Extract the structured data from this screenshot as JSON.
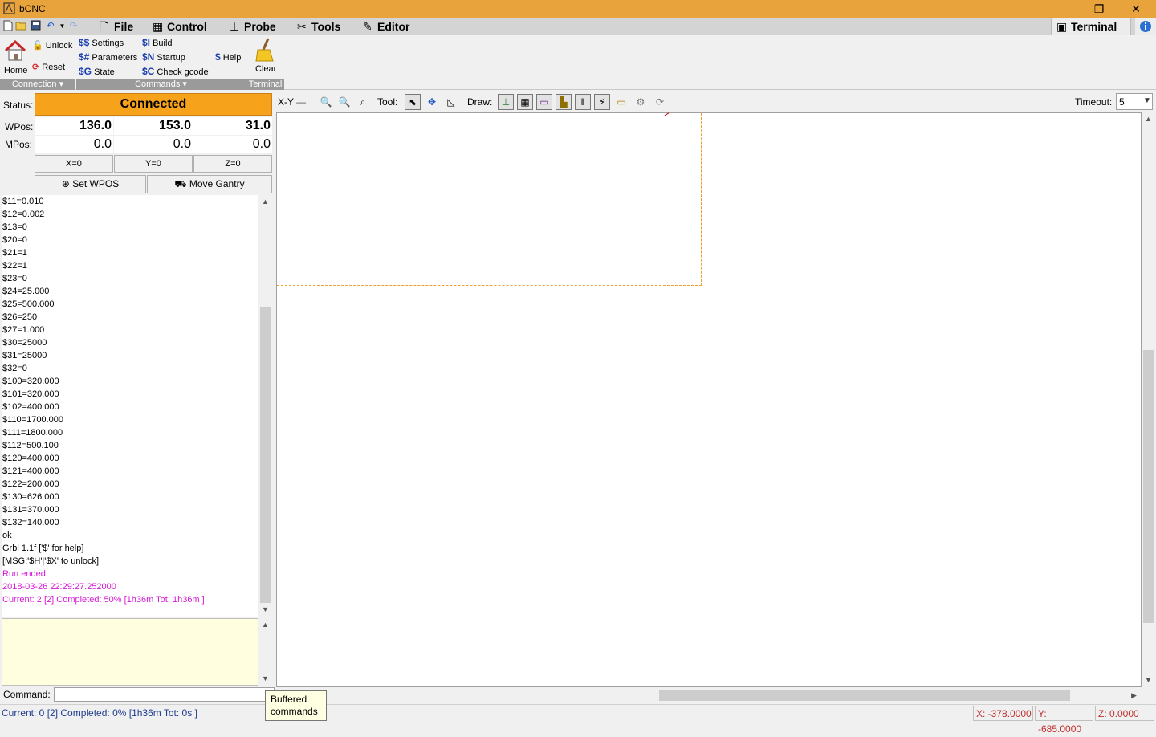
{
  "window": {
    "title": "bCNC",
    "minimize_glyph": "–",
    "restore_glyph": "❐",
    "close_glyph": "✕"
  },
  "quick_access": [
    "new-icon",
    "open-icon",
    "save-icon",
    "undo-icon",
    "dropdown-icon",
    "redo-icon"
  ],
  "menu_tabs": [
    {
      "label": "File",
      "icon": "file-icon"
    },
    {
      "label": "Control",
      "icon": "control-icon"
    },
    {
      "label": "Probe",
      "icon": "probe-icon"
    },
    {
      "label": "Tools",
      "icon": "tools-icon"
    },
    {
      "label": "Editor",
      "icon": "editor-icon"
    }
  ],
  "active_tab": {
    "label": "Terminal",
    "icon": "terminal-icon"
  },
  "ribbon": {
    "connection": {
      "home_label": "Home",
      "unlock_label": "Unlock",
      "reset_label": "Reset",
      "group_label": "Connection"
    },
    "commands": {
      "settings": {
        "prefix": "$$",
        "label": "Settings"
      },
      "parameters": {
        "prefix": "$#",
        "label": "Parameters"
      },
      "state": {
        "prefix": "$G",
        "label": "State"
      },
      "build": {
        "prefix": "$I",
        "label": "Build"
      },
      "startup": {
        "prefix": "$N",
        "label": "Startup"
      },
      "check_gcode": {
        "prefix": "$C",
        "label": "Check gcode"
      },
      "help": {
        "prefix": "$",
        "label": "Help"
      },
      "group_label": "Commands"
    },
    "terminal": {
      "clear_label": "Clear",
      "group_label": "Terminal"
    }
  },
  "status": {
    "label": "Status:",
    "value": "Connected",
    "color": "#f7a21b"
  },
  "wpos": {
    "label": "WPos:",
    "x": "136.0",
    "y": "153.0",
    "z": "31.0"
  },
  "mpos": {
    "label": "MPos:",
    "x": "0.0",
    "y": "0.0",
    "z": "0.0"
  },
  "zero_buttons": {
    "x": "X=0",
    "y": "Y=0",
    "z": "Z=0"
  },
  "set_wpos_label": "Set WPOS",
  "move_gantry_label": "Move Gantry",
  "terminal_lines": [
    "$11=0.010",
    "$12=0.002",
    "$13=0",
    "$20=0",
    "$21=1",
    "$22=1",
    "$23=0",
    "$24=25.000",
    "$25=500.000",
    "$26=250",
    "$27=1.000",
    "$30=25000",
    "$31=25000",
    "$32=0",
    "$100=320.000",
    "$101=320.000",
    "$102=400.000",
    "$110=1700.000",
    "$111=1800.000",
    "$112=500.100",
    "$120=400.000",
    "$121=400.000",
    "$122=200.000",
    "$130=626.000",
    "$131=370.000",
    "$132=140.000",
    "ok",
    "Grbl 1.1f ['$' for help]",
    "[MSG:'$H'|'$X' to unlock]"
  ],
  "terminal_highlight_lines": [
    "Run ended",
    "2018-03-26 22:29:27.252000",
    "Current: 2 [2]  Completed: 50% [1h36m Tot: 1h36m ]"
  ],
  "canvas_toolbar": {
    "view_label": "X-Y",
    "tool_label": "Tool:",
    "draw_label": "Draw:",
    "timeout_label": "Timeout:",
    "timeout_value": "5"
  },
  "command": {
    "label": "Command:",
    "value": ""
  },
  "tooltip": {
    "line1": "Buffered",
    "line2": "commands"
  },
  "statusbar": {
    "progress_text": "Current: 0 [2]  Completed: 0% [1h36m Tot: 0s ]",
    "x_coord": "X: -378.0000",
    "y_coord": "Y: -685.0000",
    "z_coord": "Z: 0.0000"
  }
}
